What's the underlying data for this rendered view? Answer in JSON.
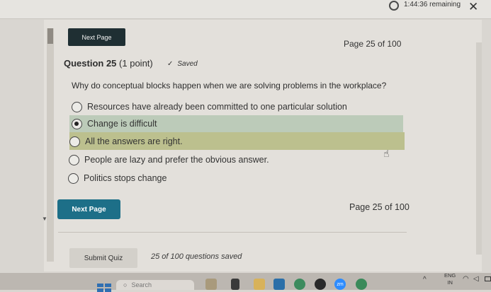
{
  "timer": {
    "remaining": "1:44:36 remaining"
  },
  "nav": {
    "next_top": "Next Page",
    "page_count_top": "Page 25 of 100",
    "next_bottom": "Next Page",
    "page_count_bottom": "Page 25 of 100"
  },
  "question": {
    "number_label": "Question 25",
    "points": "(1 point)",
    "saved_label": "Saved",
    "text": "Why do conceptual blocks happen when we are solving problems in the workplace?",
    "options": [
      {
        "label": "Resources have already been committed to one particular solution",
        "selected": false
      },
      {
        "label": "Change is difficult",
        "selected": true
      },
      {
        "label": "All the answers are right.",
        "selected": false
      },
      {
        "label": "People are lazy and prefer the obvious answer.",
        "selected": false
      },
      {
        "label": "Politics stops change",
        "selected": false
      }
    ]
  },
  "footer": {
    "submit_label": "Submit Quiz",
    "saved_count": "25 of 100 questions saved"
  },
  "taskbar": {
    "search_placeholder": "Search",
    "lang_top": "ENG",
    "lang_bottom": "IN",
    "zoom_app_label": "zm"
  },
  "colors": {
    "next_top_bg": "#1f2f33",
    "next_bottom_bg": "#1d6f88",
    "selected_highlight": "#bccbb9",
    "hover_highlight": "#bcc08e"
  }
}
